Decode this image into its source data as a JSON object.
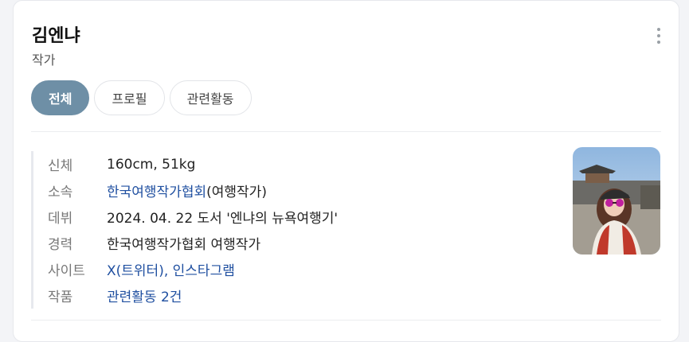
{
  "profile": {
    "name": "김엔냐",
    "role": "작가"
  },
  "tabs": [
    {
      "label": "전체",
      "active": true
    },
    {
      "label": "프로필",
      "active": false
    },
    {
      "label": "관련활동",
      "active": false
    }
  ],
  "info": {
    "body": {
      "label": "신체",
      "value": "160cm, 51kg"
    },
    "agency": {
      "label": "소속",
      "link": "한국여행작가협회",
      "suffix": "(여행작가)"
    },
    "debut": {
      "label": "데뷔",
      "value": "2024. 04. 22 도서 '엔냐의 뉴욕여행기'"
    },
    "career": {
      "label": "경력",
      "value": "한국여행작가협회 여행작가"
    },
    "site": {
      "label": "사이트",
      "link1": "X(트위터)",
      "sep": ", ",
      "link2": "인스타그램"
    },
    "works": {
      "label": "작품",
      "link": "관련활동 2건"
    }
  },
  "colors": {
    "active_tab": "#6e8fa6",
    "link": "#1f4fa0"
  },
  "icons": {
    "more": "more-vertical-icon"
  }
}
